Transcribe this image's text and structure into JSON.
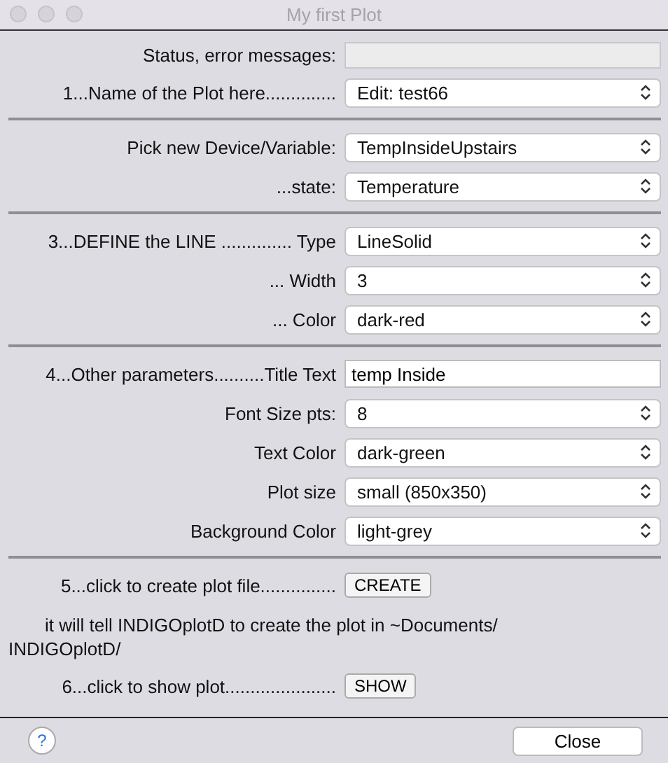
{
  "window": {
    "title": "My first Plot"
  },
  "sections": [
    {
      "rows": [
        {
          "kind": "field",
          "label": "Status, error messages:"
        },
        {
          "kind": "select",
          "label": "1...Name of the Plot here..............",
          "value": "Edit: test66"
        }
      ]
    },
    {
      "rows": [
        {
          "kind": "select",
          "label": "Pick new Device/Variable:",
          "value": "TempInsideUpstairs"
        },
        {
          "kind": "select",
          "label": "...state:",
          "value": "Temperature"
        }
      ]
    },
    {
      "rows": [
        {
          "kind": "select",
          "label": "3...DEFINE the LINE .............. Type",
          "value": "LineSolid"
        },
        {
          "kind": "select",
          "label": "... Width",
          "value": "3"
        },
        {
          "kind": "select",
          "label": "... Color",
          "value": "dark-red"
        }
      ]
    },
    {
      "rows": [
        {
          "kind": "input",
          "label": "4...Other parameters..........Title Text",
          "value": "temp Inside"
        },
        {
          "kind": "select",
          "label": "Font Size pts:",
          "value": "8"
        },
        {
          "kind": "select",
          "label": "Text  Color",
          "value": "dark-green"
        },
        {
          "kind": "select",
          "label": "Plot size",
          "value": "small (850x350)"
        },
        {
          "kind": "select",
          "label": "Background Color",
          "value": "light-grey"
        }
      ]
    },
    {
      "rows": [
        {
          "kind": "button",
          "label": "5...click to create plot file...............",
          "value": "CREATE"
        },
        {
          "kind": "note",
          "label": "it will tell INDIGOplotD to create the plot in ~Documents/ INDIGOplotD/"
        },
        {
          "kind": "button",
          "label": "6...click to show plot......................",
          "value": "SHOW"
        }
      ]
    }
  ],
  "footer": {
    "help": "?",
    "close": "Close"
  }
}
